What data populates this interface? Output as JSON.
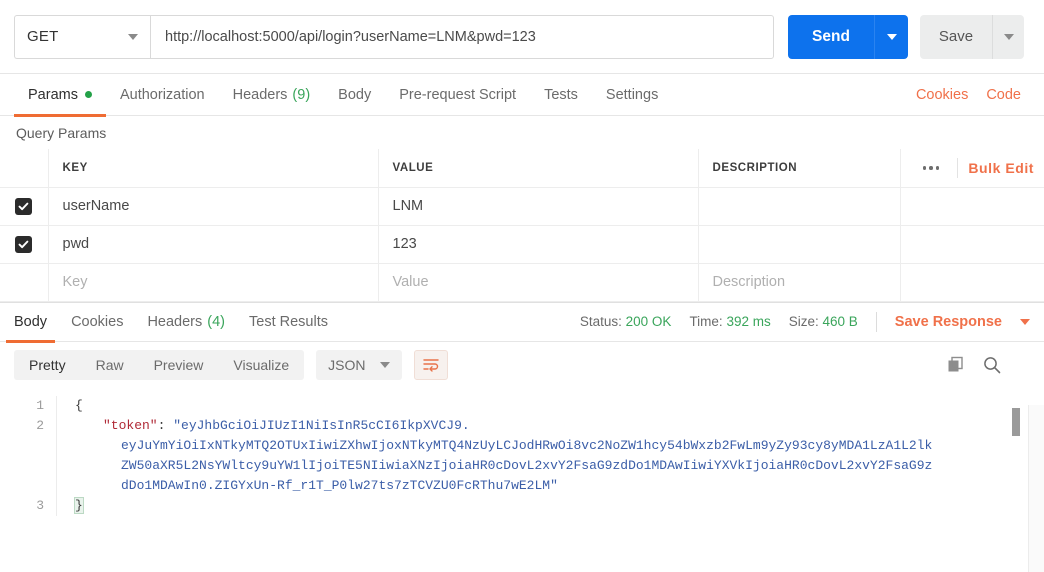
{
  "request": {
    "method": "GET",
    "url": "http://localhost:5000/api/login?userName=LNM&pwd=123",
    "send_label": "Send",
    "save_label": "Save",
    "tabs": [
      {
        "label": "Params",
        "dot": true,
        "active": true
      },
      {
        "label": "Authorization",
        "active": false
      },
      {
        "label": "Headers",
        "count": "(9)",
        "active": false
      },
      {
        "label": "Body",
        "active": false
      },
      {
        "label": "Pre-request Script",
        "active": false
      },
      {
        "label": "Tests",
        "active": false
      },
      {
        "label": "Settings",
        "active": false
      }
    ],
    "links": {
      "cookies": "Cookies",
      "code": "Code"
    }
  },
  "params": {
    "section_title": "Query Params",
    "columns": {
      "key": "KEY",
      "value": "VALUE",
      "description": "DESCRIPTION"
    },
    "bulk_edit": "Bulk Edit",
    "rows": [
      {
        "checked": true,
        "key": "userName",
        "value": "LNM",
        "description": ""
      },
      {
        "checked": true,
        "key": "pwd",
        "value": "123",
        "description": ""
      }
    ],
    "new_row": {
      "key_placeholder": "Key",
      "value_placeholder": "Value",
      "description_placeholder": "Description"
    }
  },
  "response": {
    "tabs": [
      {
        "label": "Body",
        "active": true
      },
      {
        "label": "Cookies",
        "active": false
      },
      {
        "label": "Headers",
        "count": "(4)",
        "active": false
      },
      {
        "label": "Test Results",
        "active": false
      }
    ],
    "status_label": "Status:",
    "status_value": "200 OK",
    "time_label": "Time:",
    "time_value": "392 ms",
    "size_label": "Size:",
    "size_value": "460 B",
    "save_response": "Save Response",
    "view_modes": [
      {
        "label": "Pretty",
        "active": true
      },
      {
        "label": "Raw",
        "active": false
      },
      {
        "label": "Preview",
        "active": false
      },
      {
        "label": "Visualize",
        "active": false
      }
    ],
    "format": "JSON",
    "body": {
      "line1": "{",
      "line2_key": "\"token\"",
      "line2_colon": ": ",
      "line2_value_start": "\"eyJhbGciOiJIUzI1NiIsInR5cCI6IkpXVCJ9.",
      "line2_wrap1": "eyJuYmYiOiIxNTkyMTQ2OTUxIiwiZXhwIjoxNTkyMTQ4NzUyLCJodHRwOi8vc2NoZW1hcy54bWxzb2FwLm9yZy93cy8yMDA1LzA1L2lk",
      "line2_wrap2": "ZW50aXR5L2NsYWltcy9uYW1lIjoiTE5NIiwiaXNzIjoiaHR0cDovL2xvY2FsaG9zdDo1MDAwIiwiYXVkIjoiaHR0cDovL2xvY2FsaG9z",
      "line2_wrap3": "dDo1MDAwIn0.ZIGYxUn-Rf_r1T_P0lw27ts7zTCVZU0FcRThu7wE2LM\"",
      "line3": "}",
      "line_numbers": [
        "1",
        "2",
        "3"
      ]
    }
  },
  "colors": {
    "accent_orange": "#ef6c33",
    "link_orange": "#f0714a",
    "send_blue": "#0d72ed",
    "status_green": "#3aa55b",
    "code_blue": "#3b5ea8",
    "code_key_red": "#b02a37"
  }
}
